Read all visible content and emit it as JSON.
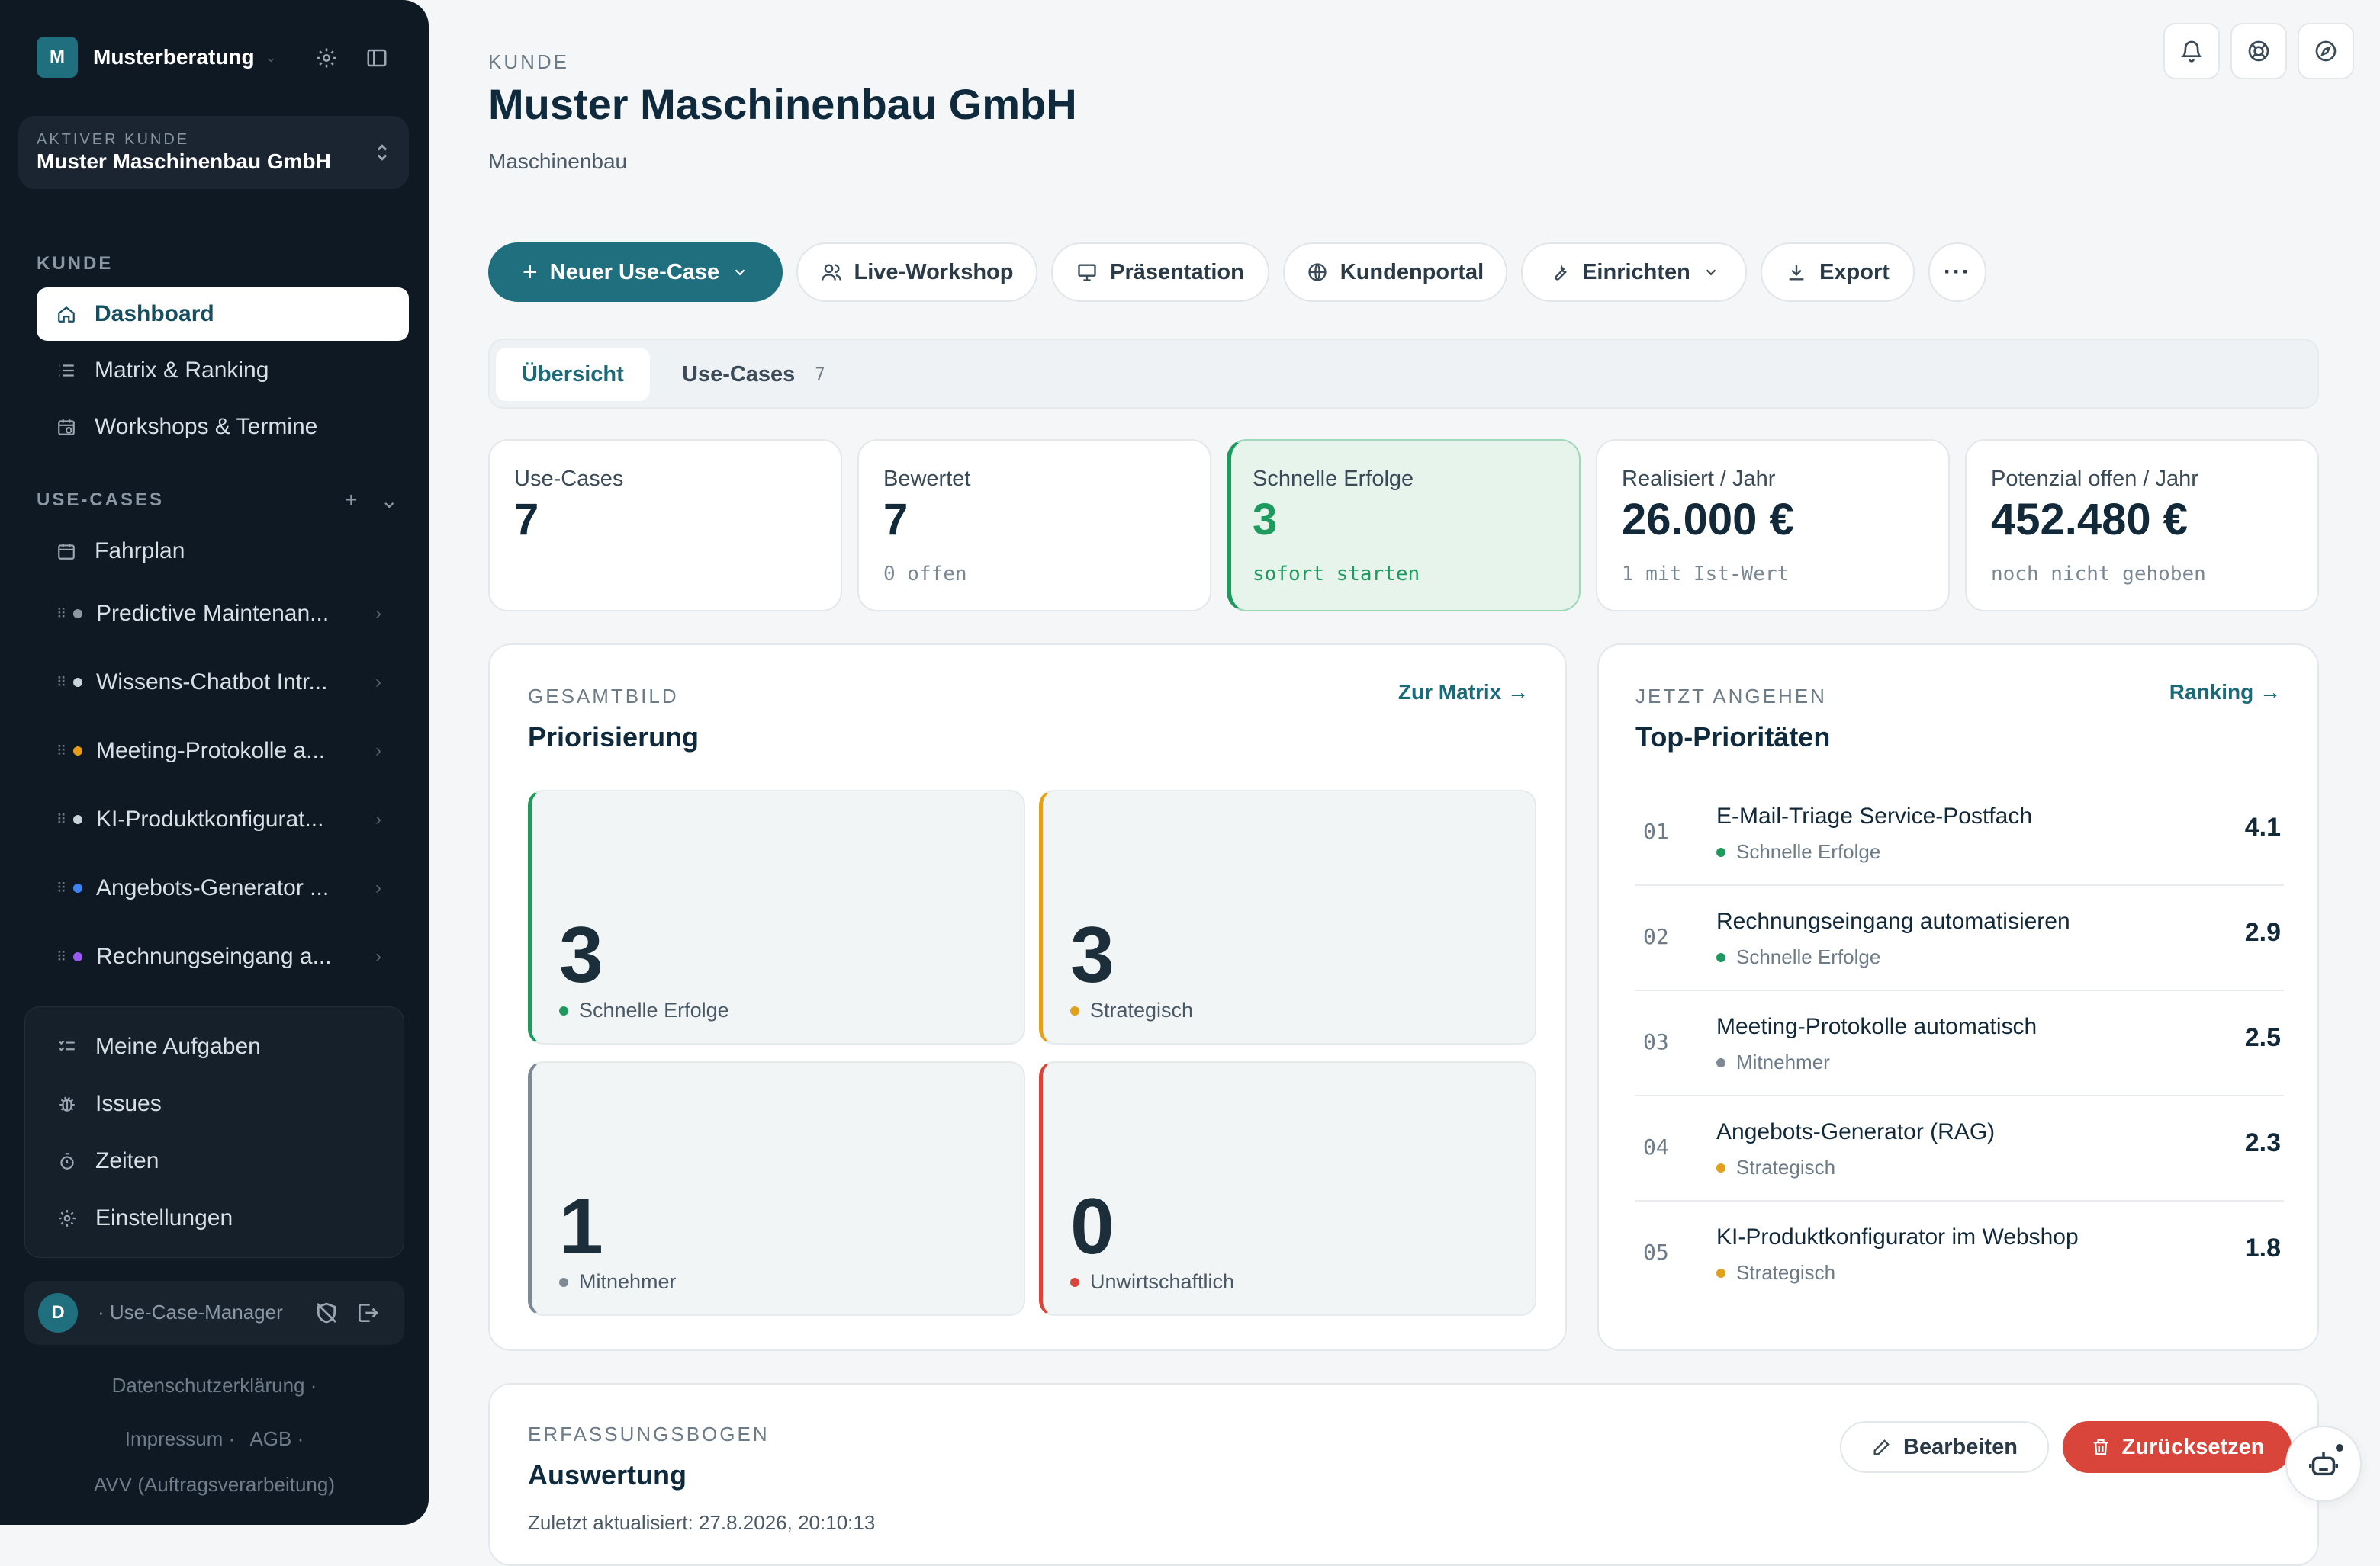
{
  "sidebar": {
    "brand": {
      "initial": "M",
      "name": "Musterberatung"
    },
    "client": {
      "eyebrow": "AKTIVER KUNDE",
      "name": "Muster Maschinenbau GmbH"
    },
    "section_kunde": "KUNDE",
    "nav": [
      {
        "label": "Dashboard",
        "icon": "home-icon",
        "active": true
      },
      {
        "label": "Matrix & Ranking",
        "icon": "list-icon"
      },
      {
        "label": "Workshops & Termine",
        "icon": "calendar-clock-icon"
      }
    ],
    "section_usecases": "USE-CASES",
    "fahrplan": "Fahrplan",
    "usecases": [
      {
        "label": "Predictive Maintenan...",
        "dot": "#8b98a3"
      },
      {
        "label": "Wissens-Chatbot Intr...",
        "dot": "#c9d1d8"
      },
      {
        "label": "Meeting-Protokolle a...",
        "dot": "#e99a19"
      },
      {
        "label": "KI-Produktkonfigurat...",
        "dot": "#c9d1d8"
      },
      {
        "label": "Angebots-Generator ...",
        "dot": "#3b82f6"
      },
      {
        "label": "Rechnungseingang a...",
        "dot": "#9b59f5"
      }
    ],
    "tools": [
      {
        "label": "Meine Aufgaben",
        "icon": "checklist-icon"
      },
      {
        "label": "Issues",
        "icon": "bug-icon"
      },
      {
        "label": "Zeiten",
        "icon": "stopwatch-icon"
      },
      {
        "label": "Einstellungen",
        "icon": "gear-icon"
      }
    ],
    "user": {
      "initial": "D",
      "role": "· Use-Case-Manager"
    },
    "legal": {
      "privacy": "Datenschutzerklärung ·",
      "imprint": "Impressum ·",
      "agb": "AGB ·",
      "avv": "AVV (Auftragsverarbeitung)"
    }
  },
  "header": {
    "eyebrow": "KUNDE",
    "title": "Muster Maschinenbau GmbH",
    "subtitle": "Maschinenbau"
  },
  "actions": {
    "new_usecase": "Neuer Use-Case",
    "workshop": "Live-Workshop",
    "presentation": "Präsentation",
    "portal": "Kundenportal",
    "setup": "Einrichten",
    "export": "Export"
  },
  "tabs": [
    {
      "label": "Übersicht",
      "active": true
    },
    {
      "label": "Use-Cases",
      "count": "7"
    }
  ],
  "kpis": [
    {
      "label": "Use-Cases",
      "value": "7",
      "note": ""
    },
    {
      "label": "Bewertet",
      "value": "7",
      "note": "0 offen"
    },
    {
      "label": "Schnelle Erfolge",
      "value": "3",
      "note": "sofort starten"
    },
    {
      "label": "Realisiert / Jahr",
      "value": "26.000 €",
      "note": "1 mit Ist-Wert"
    },
    {
      "label": "Potenzial offen / Jahr",
      "value": "452.480 €",
      "note": "noch nicht gehoben"
    }
  ],
  "gesamtbild": {
    "eyebrow": "GESAMTBILD",
    "title": "Priorisierung",
    "link": "Zur Matrix →",
    "quadrants": [
      {
        "value": "3",
        "label": "Schnelle Erfolge",
        "color": "#1f9a5e"
      },
      {
        "value": "3",
        "label": "Strategisch",
        "color": "#e2a11b"
      },
      {
        "value": "1",
        "label": "Mitnehmer",
        "color": "#7d8a95"
      },
      {
        "value": "0",
        "label": "Unwirtschaftlich",
        "color": "#d9453b"
      }
    ]
  },
  "top": {
    "eyebrow": "JETZT ANGEHEN",
    "title": "Top-Prioritäten",
    "link": "Ranking →",
    "items": [
      {
        "rank": "01",
        "title": "E-Mail-Triage Service-Postfach",
        "category": "Schnelle Erfolge",
        "color": "#1f9a5e",
        "score": "4.1"
      },
      {
        "rank": "02",
        "title": "Rechnungseingang automatisieren",
        "category": "Schnelle Erfolge",
        "color": "#1f9a5e",
        "score": "2.9"
      },
      {
        "rank": "03",
        "title": "Meeting-Protokolle automatisch",
        "category": "Mitnehmer",
        "color": "#7d8a95",
        "score": "2.5"
      },
      {
        "rank": "04",
        "title": "Angebots-Generator (RAG)",
        "category": "Strategisch",
        "color": "#e2a11b",
        "score": "2.3"
      },
      {
        "rank": "05",
        "title": "KI-Produktkonfigurator im Webshop",
        "category": "Strategisch",
        "color": "#e2a11b",
        "score": "1.8"
      }
    ]
  },
  "auswertung": {
    "eyebrow": "ERFASSUNGSBOGEN",
    "title": "Auswertung",
    "updated": "Zuletzt aktualisiert: 27.8.2026, 20:10:13",
    "edit": "Bearbeiten",
    "reset": "Zurücksetzen"
  },
  "colors": {
    "accent": "#1f6f7e",
    "danger": "#d9453b",
    "success": "#1f9a5e",
    "sidebar": "#0f1923"
  }
}
